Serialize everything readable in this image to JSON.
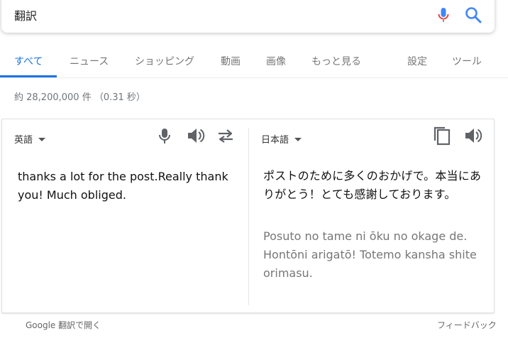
{
  "search": {
    "query": "翻訳",
    "icons": {
      "mic": "microphone-icon",
      "search": "search-icon"
    },
    "colors": {
      "mic_blue": "#4285f4",
      "mic_red": "#ea4335",
      "mic_grey": "#999999",
      "search_blue": "#4285f4"
    }
  },
  "tabs": [
    {
      "label": "すべて",
      "active": true
    },
    {
      "label": "ニュース"
    },
    {
      "label": "ショッピング"
    },
    {
      "label": "動画"
    },
    {
      "label": "画像"
    },
    {
      "label": "もっと見る"
    },
    {
      "label": "設定"
    },
    {
      "label": "ツール"
    }
  ],
  "accent_color": "#1a73e8",
  "result_stats": "約 28,200,000 件 （0.31 秒）",
  "translator": {
    "source_lang": "英語",
    "target_lang": "日本語",
    "source_text": "thanks a lot for the post.Really thank you! Much obliged.",
    "target_text": "ポストのために多くのおかげで。本当にありがとう！とても感謝しております。",
    "romanization": "Posuto no tame ni ōku no okage de. Hontōni arigatō! Totemo kansha shite orimasu.",
    "icons": {
      "source_mic": "microphone-icon",
      "source_speaker": "speaker-icon",
      "swap": "swap-languages-icon",
      "copy": "copy-icon",
      "target_speaker": "speaker-icon"
    }
  },
  "footer": {
    "open_in": "Google 翻訳で開く",
    "feedback": "フィードバック"
  }
}
